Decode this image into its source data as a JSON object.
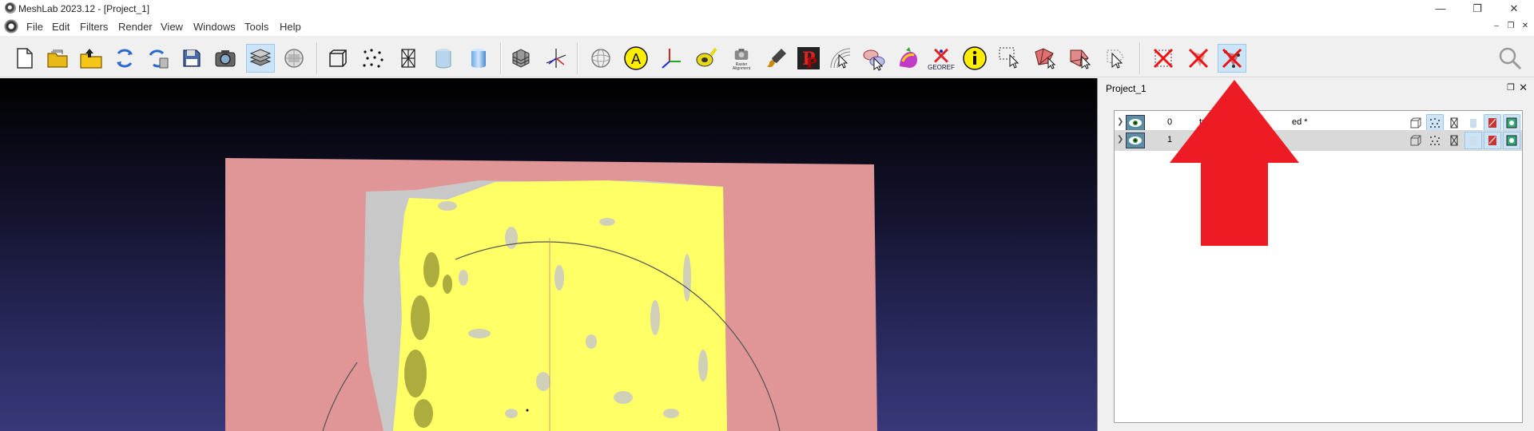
{
  "window": {
    "title": "MeshLab 2023.12 - [Project_1]",
    "controls": [
      "—",
      "❐",
      "✕"
    ]
  },
  "menubar": {
    "items": [
      "File",
      "Edit",
      "Filters",
      "Render",
      "View",
      "Windows",
      "Tools",
      "Help"
    ],
    "mdi_controls": [
      "–",
      "❐",
      "✕"
    ]
  },
  "toolbar": {
    "raster_label": "Raster\nAlignment",
    "georef_label": "GEOREF",
    "annot_letter": "A"
  },
  "panel": {
    "title": "Project_1",
    "float_glyph": "❐",
    "close_glyph": "✕",
    "layers": [
      {
        "index": "0",
        "name": "trts",
        "name_suffix": "ed *",
        "selected": false
      },
      {
        "index": "1",
        "name": "",
        "name_suffix": "",
        "selected": true
      }
    ]
  },
  "colors": {
    "mesh_pink": "#e09696",
    "mesh_yellow": "#ffff66",
    "mesh_gray": "#c8c8c8",
    "arrow_red": "#ed1c24",
    "selection_blue": "#cce4f7"
  }
}
